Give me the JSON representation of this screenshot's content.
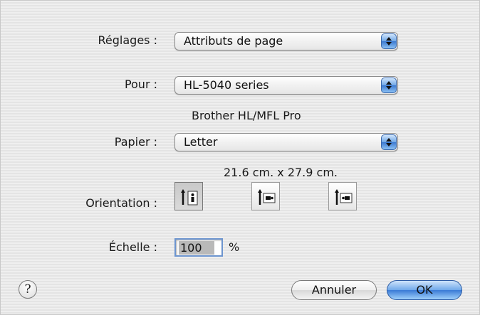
{
  "settings": {
    "label": "Réglages :",
    "value": "Attributs de page"
  },
  "format_for": {
    "label": "Pour :",
    "value": "HL-5040 series",
    "driver": "Brother HL/MFL Pro"
  },
  "paper": {
    "label": "Papier :",
    "value": "Letter",
    "dimensions": "21.6 cm. x 27.9 cm."
  },
  "orientation": {
    "label": "Orientation :",
    "options": [
      {
        "name": "portrait",
        "icon": "portrait-orientation-icon",
        "selected": true
      },
      {
        "name": "landscape-left",
        "icon": "landscape-left-orientation-icon",
        "selected": false
      },
      {
        "name": "landscape-right",
        "icon": "landscape-right-orientation-icon",
        "selected": false
      }
    ]
  },
  "scale": {
    "label": "Échelle :",
    "value": "100",
    "unit": "%"
  },
  "buttons": {
    "help": "?",
    "cancel": "Annuler",
    "ok": "OK"
  },
  "colors": {
    "accent": "#3a7bd6",
    "focus_ring": "#6d95cf"
  }
}
